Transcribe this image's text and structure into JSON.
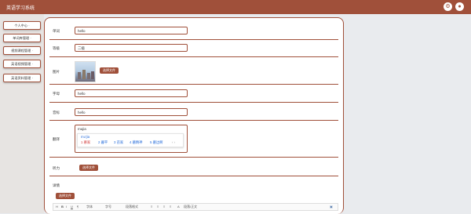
{
  "header": {
    "title": "英语学习系统",
    "colors": {
      "brand": "#a0503a"
    }
  },
  "header_icons": [
    "settings-icon",
    "user-icon"
  ],
  "sidebar": {
    "items": [
      "个人中心 ·",
      "单词库管理 ·",
      "视频课程管理 ·",
      "英语视频管理 ·",
      "英语资料管理 ·"
    ]
  },
  "form": {
    "word": {
      "label": "单词",
      "value": "hello"
    },
    "level": {
      "label": "等级",
      "value": "二级"
    },
    "image": {
      "label": "图片",
      "button": "选择文件"
    },
    "letter": {
      "label": "字母",
      "value": "hello"
    },
    "phonetic": {
      "label": "音标",
      "value": "hello"
    },
    "translation": {
      "label": "翻译",
      "value": "mujia"
    },
    "audio": {
      "label": "听力",
      "button": "选择文件"
    },
    "detail": {
      "label": "详情",
      "button": "选择文件"
    }
  },
  "ime": {
    "pinyin": "mu'jia",
    "candidates": [
      "1 慕家",
      "2 暮平",
      "3 苗家",
      "4 墓精神",
      "5 墓边啊"
    ],
    "arrows": "‹ ›"
  },
  "editor_toolbar": [
    "H",
    "B",
    "I",
    "U",
    "¶",
    "字体",
    "字号",
    "段落格式",
    "≡",
    "≡",
    "≡",
    "≡",
    "A",
    "段落/正文",
    "▣"
  ]
}
